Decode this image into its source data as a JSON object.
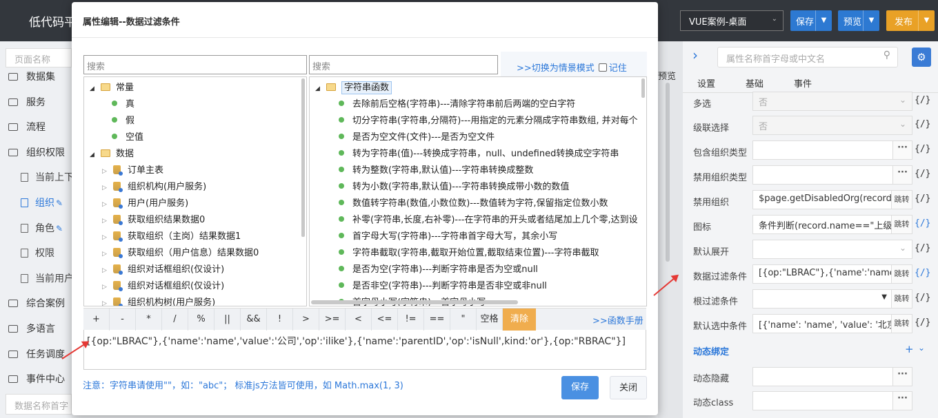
{
  "app": {
    "title": "低代码平台",
    "case_select": "VUE案例-桌面",
    "save": "保存",
    "preview": "预览",
    "publish": "发布",
    "bg_text": "预览"
  },
  "colors": {
    "save": "#2d79d2",
    "preview": "#2d79d2",
    "publish": "#e9a126",
    "dark": "#33373d"
  },
  "left_nav": {
    "search_placeholder": "页面名称",
    "bottom_placeholder": "数据名称首字",
    "items": [
      {
        "label": "数据集",
        "type": "folder"
      },
      {
        "label": "服务",
        "type": "folder"
      },
      {
        "label": "流程",
        "type": "folder"
      },
      {
        "label": "组织权限",
        "type": "folder"
      },
      {
        "label": "当前上下",
        "type": "doc"
      },
      {
        "label": "组织",
        "type": "doc",
        "active": true,
        "editable": true
      },
      {
        "label": "角色",
        "type": "doc",
        "editable": true
      },
      {
        "label": "权限",
        "type": "doc"
      },
      {
        "label": "当前用户",
        "type": "doc"
      },
      {
        "label": "综合案例",
        "type": "folder"
      },
      {
        "label": "多语言",
        "type": "folder"
      },
      {
        "label": "任务调度",
        "type": "folder"
      },
      {
        "label": "事件中心",
        "type": "folder"
      }
    ]
  },
  "right_panel": {
    "search_placeholder": "属性名称首字母或中文名",
    "tabs": [
      "设置",
      "基础",
      "事件"
    ],
    "section_dynamic": "动态绑定",
    "rows": [
      {
        "label": "多选",
        "value": "否",
        "kind": "select",
        "disabled": true
      },
      {
        "label": "级联选择",
        "value": "否",
        "kind": "select",
        "disabled": true
      },
      {
        "label": "包含组织类型",
        "value": "",
        "kind": "dots"
      },
      {
        "label": "禁用组织类型",
        "value": "",
        "kind": "dots"
      },
      {
        "label": "禁用组织",
        "value": "$page.getDisabledOrg(record)",
        "kind": "jump"
      },
      {
        "label": "图标",
        "value": "条件判断(record.name==\"上级",
        "kind": "jump"
      },
      {
        "label": "默认展开",
        "value": "",
        "kind": "select"
      },
      {
        "label": "数据过滤条件",
        "value": "[{op:\"LBRAC\"},{'name':'name'",
        "kind": "jump"
      },
      {
        "label": "根过滤条件",
        "value": "",
        "kind": "jumpsel"
      },
      {
        "label": "默认选中条件",
        "value": "[{'name': 'name', 'value': '北京",
        "kind": "jump"
      }
    ],
    "dynamic_rows": [
      {
        "label": "动态隐藏",
        "value": ""
      },
      {
        "label": "动态class",
        "value": ""
      }
    ],
    "js_label": "{/}",
    "jump_label": "跳转",
    "dots_label": "···"
  },
  "dialog": {
    "title": "属性编辑--数据过滤条件",
    "search_left": "搜索",
    "search_right": "搜索",
    "switch_mode": ">>切换为情景模式",
    "remember": "记住",
    "manual": ">>函数手册",
    "left_tree": [
      {
        "level": 0,
        "label": "常量",
        "kind": "folder",
        "open": true
      },
      {
        "level": 1,
        "label": "真",
        "kind": "leaf"
      },
      {
        "level": 1,
        "label": "假",
        "kind": "leaf"
      },
      {
        "level": 1,
        "label": "空值",
        "kind": "leaf"
      },
      {
        "level": 0,
        "label": "数据",
        "kind": "folder",
        "open": true
      },
      {
        "level": 1,
        "label": "订单主表",
        "kind": "db"
      },
      {
        "level": 1,
        "label": "组织机构(用户服务)",
        "kind": "db"
      },
      {
        "level": 1,
        "label": "用户(用户服务)",
        "kind": "db"
      },
      {
        "level": 1,
        "label": "获取组织结果数据0",
        "kind": "db"
      },
      {
        "level": 1,
        "label": "获取组织（主岗）结果数据1",
        "kind": "db"
      },
      {
        "level": 1,
        "label": "获取组织（用户信息）结果数据0",
        "kind": "db"
      },
      {
        "level": 1,
        "label": "组织对话框组织(仅设计)",
        "kind": "db"
      },
      {
        "level": 1,
        "label": "组织对话框组织(仅设计)",
        "kind": "db"
      },
      {
        "level": 1,
        "label": "组织机构树(用户服务)",
        "kind": "db"
      }
    ],
    "right_tree_root": "字符串函数",
    "functions": [
      "去除前后空格(字符串)---清除字符串前后两端的空白字符",
      "切分字符串(字符串,分隔符)---用指定的元素分隔成字符串数组, 并对每个",
      "是否为空文件(文件)---是否为空文件",
      "转为字符串(值)---转换成字符串，null、undefined转换成空字符串",
      "转为整数(字符串,默认值)---字符串转换成整数",
      "转为小数(字符串,默认值)---字符串转换成带小数的数值",
      "数值转字符串(数值,小数位数)---数值转为字符,保留指定位数小数",
      "补零(字符串,长度,右补零)---在字符串的开头或者结尾加上几个零,达到设",
      "首字母大写(字符串)---字符串首字母大写，其余小写",
      "字符串截取(字符串,截取开始位置,截取结束位置)---字符串截取",
      "是否为空(字符串)---判断字符串是否为空或null",
      "是否非空(字符串)---判断字符串是否非空或非null",
      "首字母小写(字符串)---首字母小写"
    ],
    "operators": [
      "+",
      "-",
      "*",
      "/",
      "%",
      "||",
      "&&",
      "!",
      ">",
      ">=",
      "<",
      "<=",
      "!=",
      "==",
      "\"",
      "空格",
      "清除"
    ],
    "expression": "[{op:\"LBRAC\"},{'name':'name','value':'公司','op':'ilike'},{'name':'parentID','op':'isNull',kind:'or'},{op:\"RBRAC\"}]",
    "note": "注意：字符串请使用\"\"，如：\"abc\"；  标准js方法皆可使用，如 Math.max(1, 3)",
    "save": "保存",
    "close": "关闭"
  }
}
